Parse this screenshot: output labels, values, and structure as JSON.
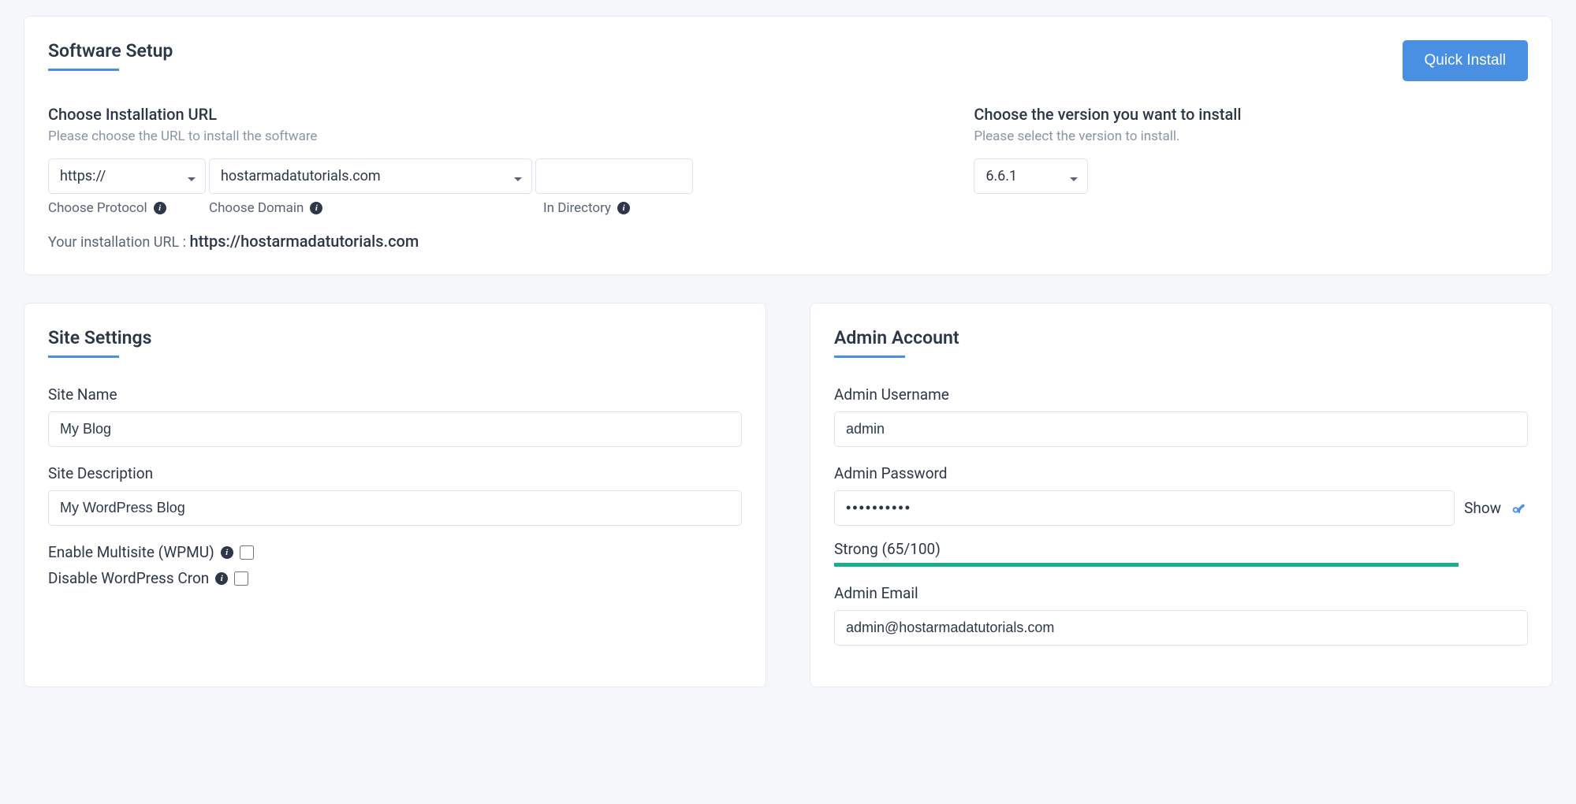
{
  "software_setup": {
    "title": "Software Setup",
    "quick_install_label": "Quick Install",
    "url_section": {
      "label": "Choose Installation URL",
      "sublabel": "Please choose the URL to install the software",
      "protocol": {
        "value": "https://",
        "label": "Choose Protocol"
      },
      "domain": {
        "value": "hostarmadatutorials.com",
        "label": "Choose Domain"
      },
      "directory": {
        "value": "",
        "label": "In Directory"
      },
      "display_prefix": "Your installation URL : ",
      "display_url": "https://hostarmadatutorials.com"
    },
    "version_section": {
      "label": "Choose the version you want to install",
      "sublabel": "Please select the version to install.",
      "value": "6.6.1"
    }
  },
  "site_settings": {
    "title": "Site Settings",
    "name": {
      "label": "Site Name",
      "value": "My Blog"
    },
    "desc": {
      "label": "Site Description",
      "value": "My WordPress Blog"
    },
    "multisite": {
      "label": "Enable Multisite (WPMU)"
    },
    "cron": {
      "label": "Disable WordPress Cron"
    }
  },
  "admin": {
    "title": "Admin Account",
    "username": {
      "label": "Admin Username",
      "value": "admin"
    },
    "password": {
      "label": "Admin Password",
      "value": "••••••••••",
      "show_label": "Show",
      "strength": "Strong (65/100)"
    },
    "email": {
      "label": "Admin Email",
      "value": "admin@hostarmadatutorials.com"
    }
  }
}
